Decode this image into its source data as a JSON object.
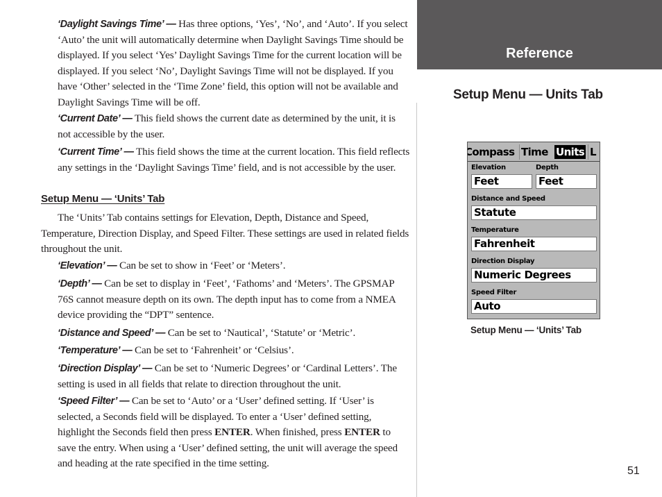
{
  "banner": {
    "title": "Reference",
    "color": "#5b595a"
  },
  "right": {
    "heading": "Setup Menu — Units Tab",
    "caption": "Setup Menu — ‘Units’ Tab"
  },
  "device": {
    "tabs": [
      {
        "label": "Compass",
        "active": false
      },
      {
        "label": "Time",
        "active": false
      },
      {
        "label": "Units",
        "active": true
      },
      {
        "label": "L",
        "active": false
      }
    ],
    "fields": {
      "elevation": {
        "label": "Elevation",
        "value": "Feet"
      },
      "depth": {
        "label": "Depth",
        "value": "Feet"
      },
      "distance_speed": {
        "label": "Distance and Speed",
        "value": "Statute"
      },
      "temperature": {
        "label": "Temperature",
        "value": "Fahrenheit"
      },
      "direction_display": {
        "label": "Direction Display",
        "value": "Numeric Degrees"
      },
      "speed_filter": {
        "label": "Speed Filter",
        "value": "Auto"
      }
    }
  },
  "left": {
    "dst": {
      "term": "‘Daylight Savings Time’ —",
      "text": " Has three options, ‘Yes’, ‘No’, and ‘Auto’.  If you select ‘Auto’ the unit will automatically determine when Daylight Savings Time should be displayed.  If you select ‘Yes’ Daylight Savings Time for the current location will be displayed.  If you select ‘No’, Daylight Savings Time will not be displayed.  If you have ‘Other’ selected in the ‘Time Zone’ field, this option will not be available and Daylight Savings Time will be off."
    },
    "current_date": {
      "term": "‘Current Date’ —",
      "text": " This field shows the current date as determined by the unit, it is not accessible by the user."
    },
    "current_time": {
      "term": "‘Current Time’ —",
      "text": " This field shows the time at the current location. This field reflects any settings in the ‘Daylight Savings Time’ field, and is not accessible by the user."
    },
    "section_heading": "Setup Menu — ‘Units’ Tab",
    "intro": "The ‘Units’ Tab contains settings for Elevation, Depth, Distance and Speed, Temperature, Direction Display, and Speed Filter. These settings are used in related fields throughout the unit.",
    "elevation": {
      "term": "‘Elevation’ —",
      "text": " Can be set to show in ‘Feet’ or ‘Meters’."
    },
    "depth": {
      "term": "‘Depth’ —",
      "text": " Can be set to display in ‘Feet’, ‘Fathoms’ and ‘Meters’.  The GPSMAP 76S cannot measure depth on its own.  The depth input has to come from a NMEA device providing the “DPT” sentence."
    },
    "distance_speed": {
      "term": "‘Distance and Speed’ —",
      "text": " Can be set to ‘Nautical’, ‘Statute’ or ‘Metric’."
    },
    "temperature": {
      "term": "‘Temperature’ —",
      "text": " Can be set to ‘Fahrenheit’ or ‘Celsius’."
    },
    "direction_display": {
      "term": "‘Direction Display’ —",
      "text": " Can be set to ‘Numeric Degrees’ or ‘Cardinal Letters’. The setting is used in all fields that relate to direction throughout the unit."
    },
    "speed_filter": {
      "term": "‘Speed Filter’ —",
      "text1": " Can be set to ‘Auto’ or a ‘User’ defined setting.  If ‘User’ is selected, a Seconds field will be displayed.  To enter a ‘User’ defined setting, highlight the Seconds field then press ",
      "key1": "ENTER",
      "text2": ".  When finished, press ",
      "key2": "ENTER",
      "text3": " to save the entry.  When using a ‘User’ defined setting, the unit will average the speed and heading at the rate specified in the time setting."
    }
  },
  "page_number": "51"
}
